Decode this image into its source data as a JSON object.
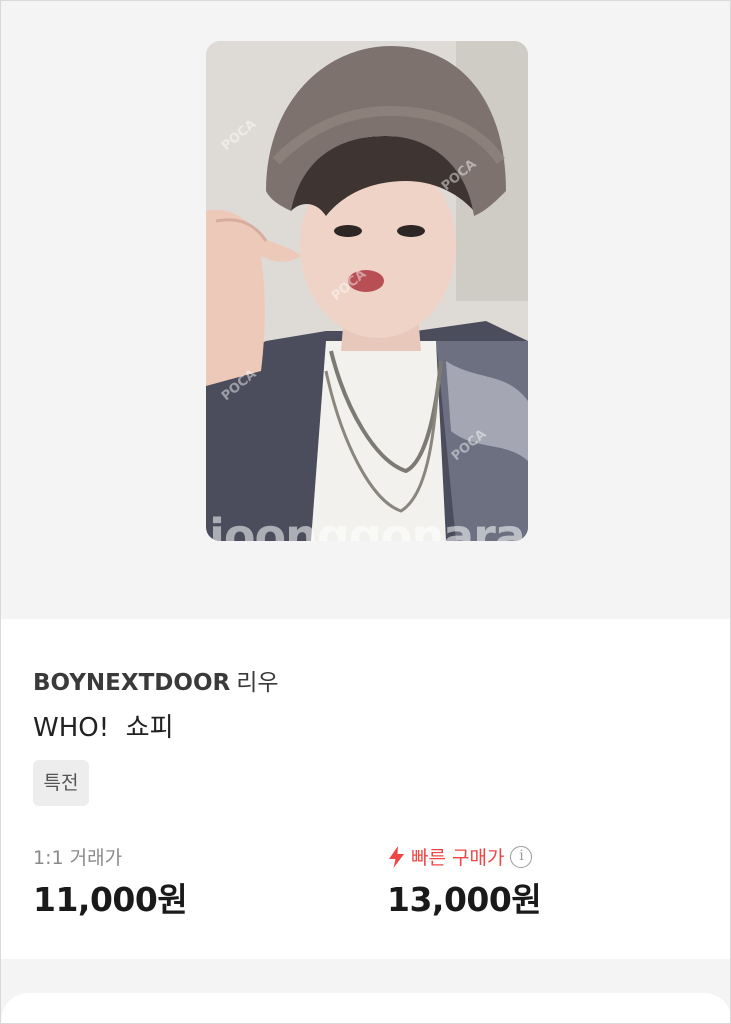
{
  "product": {
    "artist": "BOYNEXTDOOR",
    "member": "리우",
    "title": "WHO!  쇼피",
    "tag": "특전",
    "image_watermark": "joonggonara"
  },
  "prices": {
    "direct": {
      "label": "1:1 거래가",
      "value": "11,000원"
    },
    "quick": {
      "label": "빠른 구매가",
      "value": "13,000원",
      "icon": "lightning-bolt-icon",
      "info_icon": "info-icon",
      "info_glyph": "i"
    }
  },
  "colors": {
    "accent_red": "#f04545",
    "background_gray": "#f4f4f4",
    "tag_bg": "#ededed"
  }
}
